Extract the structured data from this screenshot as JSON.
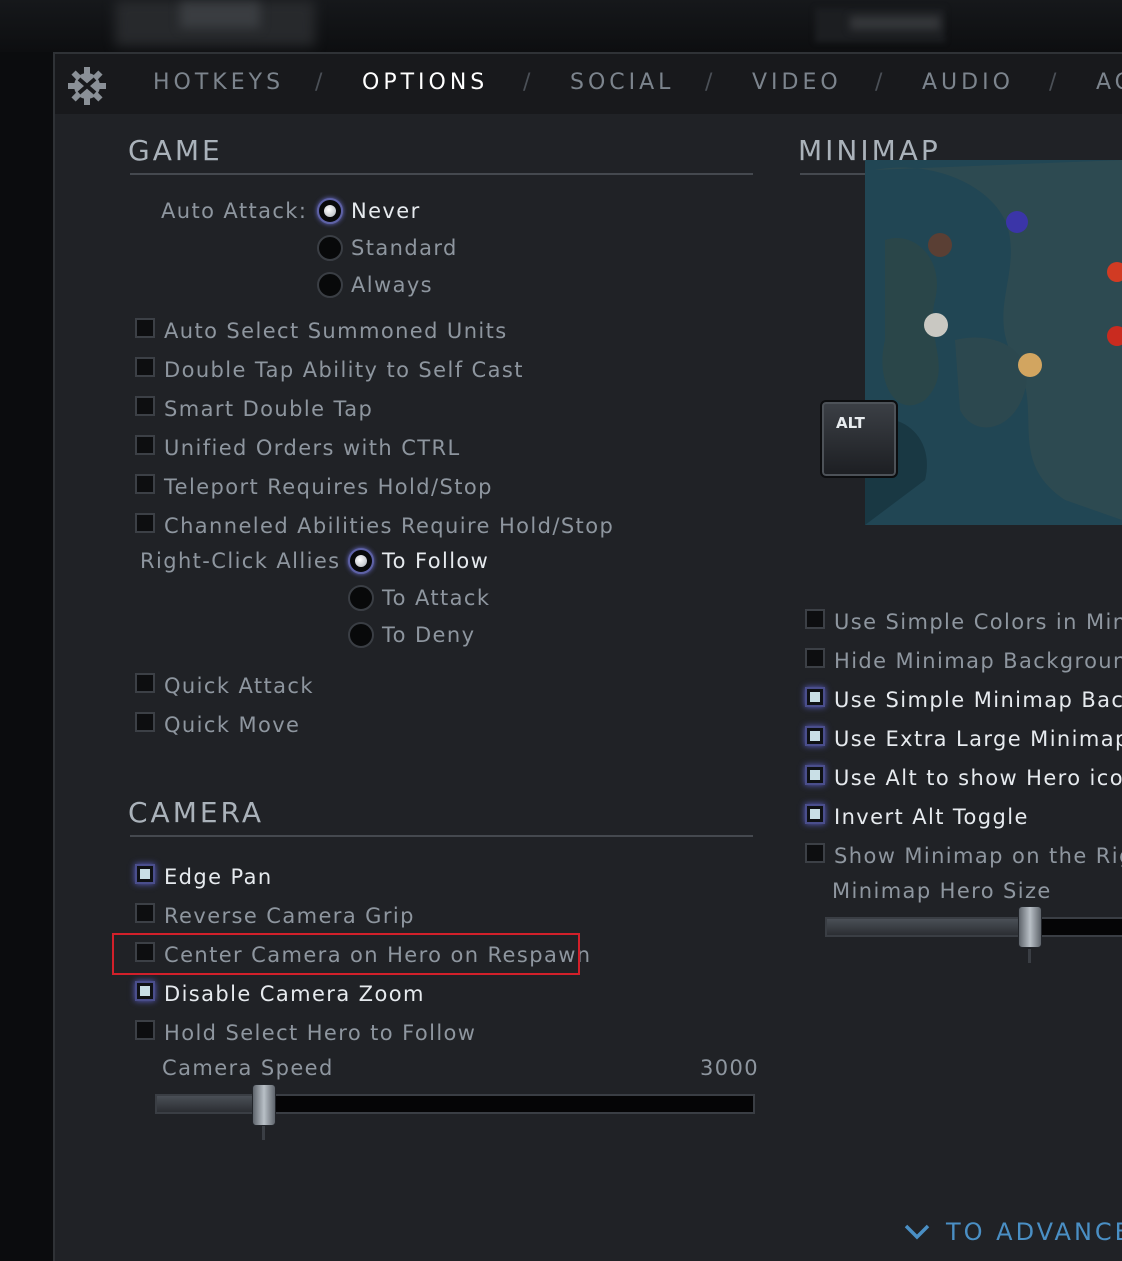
{
  "tabs": [
    {
      "label": "HOTKEYS",
      "active": false
    },
    {
      "label": "OPTIONS",
      "active": true
    },
    {
      "label": "SOCIAL",
      "active": false
    },
    {
      "label": "VIDEO",
      "active": false
    },
    {
      "label": "AUDIO",
      "active": false
    },
    {
      "label": "AC",
      "active": false
    }
  ],
  "tab_separator": "/",
  "game": {
    "title": "GAME",
    "auto_attack": {
      "label": "Auto Attack:",
      "options": [
        {
          "label": "Never",
          "selected": true
        },
        {
          "label": "Standard",
          "selected": false
        },
        {
          "label": "Always",
          "selected": false
        }
      ]
    },
    "checkboxes_top": [
      {
        "label": "Auto Select Summoned Units",
        "checked": false
      },
      {
        "label": "Double Tap Ability to Self Cast",
        "checked": false
      },
      {
        "label": "Smart Double Tap",
        "checked": false
      },
      {
        "label": "Unified Orders with CTRL",
        "checked": false
      },
      {
        "label": "Teleport Requires Hold/Stop",
        "checked": false
      },
      {
        "label": "Channeled Abilities Require Hold/Stop",
        "checked": false
      }
    ],
    "right_click_allies": {
      "label": "Right-Click Allies",
      "options": [
        {
          "label": "To Follow",
          "selected": true
        },
        {
          "label": "To Attack",
          "selected": false
        },
        {
          "label": "To Deny",
          "selected": false
        }
      ]
    },
    "checkboxes_bottom": [
      {
        "label": "Quick Attack",
        "checked": false
      },
      {
        "label": "Quick Move",
        "checked": false
      }
    ]
  },
  "camera": {
    "title": "CAMERA",
    "checkboxes": [
      {
        "label": "Edge Pan",
        "checked": true
      },
      {
        "label": "Reverse Camera Grip",
        "checked": false
      },
      {
        "label": "Center Camera on Hero on Respawn",
        "checked": false
      },
      {
        "label": "Disable Camera Zoom",
        "checked": true
      },
      {
        "label": "Hold Select Hero to Follow",
        "checked": false
      }
    ],
    "speed_label": "Camera Speed",
    "speed_value": "3000",
    "speed_fraction": 0.18
  },
  "minimap": {
    "title": "MINIMAP",
    "alt_key": "ALT",
    "checkboxes": [
      {
        "label": "Use Simple Colors in Minir",
        "checked": false
      },
      {
        "label": "Hide Minimap Backgrounc",
        "checked": false
      },
      {
        "label": "Use Simple Minimap Backg",
        "checked": true
      },
      {
        "label": "Use Extra Large Minimap",
        "checked": true
      },
      {
        "label": "Use Alt to show Hero icon",
        "checked": true
      },
      {
        "label": "Invert Alt Toggle",
        "checked": true
      },
      {
        "label": "Show Minimap on the Righ",
        "checked": false
      }
    ],
    "hero_size_label": "Minimap Hero Size",
    "hero_size_fraction": 0.6
  },
  "footer": {
    "advanced_label": "TO ADVANCE"
  },
  "colors": {
    "accent_blue": "#4a8fc4",
    "highlight_red": "#d2202a",
    "panel_bg": "#202226"
  }
}
